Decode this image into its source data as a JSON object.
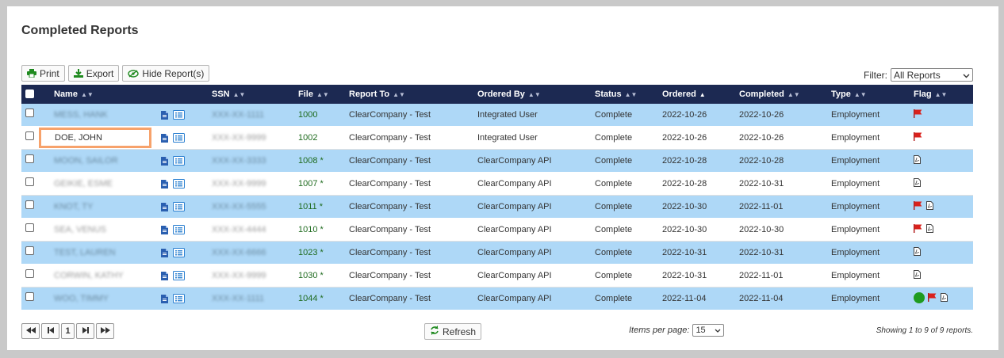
{
  "page": {
    "title": "Completed Reports"
  },
  "toolbar": {
    "print_label": "Print",
    "export_label": "Export",
    "hide_label": "Hide Report(s)"
  },
  "filter": {
    "label": "Filter:",
    "selected": "All Reports"
  },
  "columns": {
    "name": "Name",
    "ssn": "SSN",
    "file": "File",
    "report_to": "Report To",
    "ordered_by": "Ordered By",
    "status": "Status",
    "ordered": "Ordered",
    "completed": "Completed",
    "type": "Type",
    "flag": "Flag"
  },
  "rows": [
    {
      "name": "MESS, HANK",
      "ssn": "XXX-XX-1111",
      "file": "1000",
      "report_to": "ClearCompany - Test",
      "ordered_by": "Integrated User",
      "status": "Complete",
      "ordered": "2022-10-26",
      "completed": "2022-10-26",
      "type": "Employment",
      "flags": [
        "red-flag"
      ]
    },
    {
      "name": "DOE, JOHN",
      "ssn": "XXX-XX-9999",
      "file": "1002",
      "report_to": "ClearCompany - Test",
      "ordered_by": "Integrated User",
      "status": "Complete",
      "ordered": "2022-10-26",
      "completed": "2022-10-26",
      "type": "Employment",
      "flags": [
        "red-flag"
      ]
    },
    {
      "name": "MOON, SAILOR",
      "ssn": "XXX-XX-3333",
      "file": "1008 *",
      "report_to": "ClearCompany - Test",
      "ordered_by": "ClearCompany API",
      "status": "Complete",
      "ordered": "2022-10-28",
      "completed": "2022-10-28",
      "type": "Employment",
      "flags": [
        "pdf"
      ]
    },
    {
      "name": "GEIKIE, ESME",
      "ssn": "XXX-XX-9999",
      "file": "1007 *",
      "report_to": "ClearCompany - Test",
      "ordered_by": "ClearCompany API",
      "status": "Complete",
      "ordered": "2022-10-28",
      "completed": "2022-10-31",
      "type": "Employment",
      "flags": [
        "pdf"
      ]
    },
    {
      "name": "KNOT, TY",
      "ssn": "XXX-XX-5555",
      "file": "1011 *",
      "report_to": "ClearCompany - Test",
      "ordered_by": "ClearCompany API",
      "status": "Complete",
      "ordered": "2022-10-30",
      "completed": "2022-11-01",
      "type": "Employment",
      "flags": [
        "red-flag",
        "pdf"
      ]
    },
    {
      "name": "SEA, VENUS",
      "ssn": "XXX-XX-4444",
      "file": "1010 *",
      "report_to": "ClearCompany - Test",
      "ordered_by": "ClearCompany API",
      "status": "Complete",
      "ordered": "2022-10-30",
      "completed": "2022-10-30",
      "type": "Employment",
      "flags": [
        "red-flag",
        "pdf"
      ]
    },
    {
      "name": "TEST, LAUREN",
      "ssn": "XXX-XX-6666",
      "file": "1023 *",
      "report_to": "ClearCompany - Test",
      "ordered_by": "ClearCompany API",
      "status": "Complete",
      "ordered": "2022-10-31",
      "completed": "2022-10-31",
      "type": "Employment",
      "flags": [
        "pdf"
      ]
    },
    {
      "name": "CORWIN, KATHY",
      "ssn": "XXX-XX-9999",
      "file": "1030 *",
      "report_to": "ClearCompany - Test",
      "ordered_by": "ClearCompany API",
      "status": "Complete",
      "ordered": "2022-10-31",
      "completed": "2022-11-01",
      "type": "Employment",
      "flags": [
        "pdf"
      ]
    },
    {
      "name": "WOO, TIMMY",
      "ssn": "XXX-XX-1111",
      "file": "1044 *",
      "report_to": "ClearCompany - Test",
      "ordered_by": "ClearCompany API",
      "status": "Complete",
      "ordered": "2022-11-04",
      "completed": "2022-11-04",
      "type": "Employment",
      "flags": [
        "green-circle",
        "red-flag",
        "pdf"
      ]
    }
  ],
  "pagination": {
    "page": "1",
    "refresh_label": "Refresh",
    "items_label": "Items per page:",
    "items_value": "15",
    "showing": "Showing 1 to 9 of 9 reports."
  },
  "colors": {
    "header": "#1c2952",
    "row_blue": "#aed8f7",
    "highlight": "#f7a26b",
    "flag_red": "#d9211c",
    "green": "#1f9b1f"
  }
}
